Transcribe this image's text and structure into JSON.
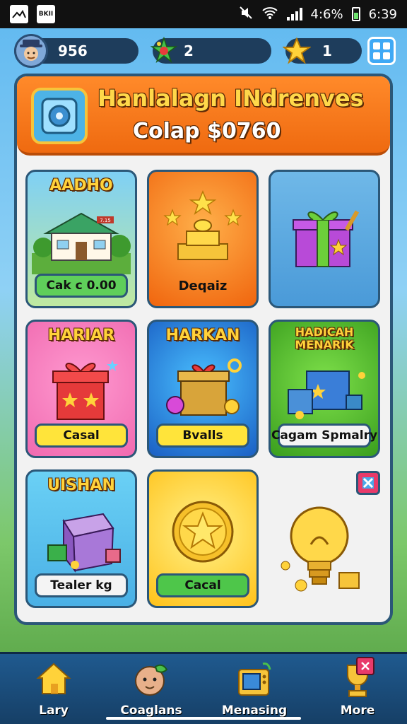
{
  "status_bar": {
    "battery": "4:6%",
    "time": "6:39",
    "app_badge": "BKII"
  },
  "resources": {
    "coins": "956",
    "gems": "2",
    "stars": "1"
  },
  "header": {
    "title": "Hanlalagn INdrenves",
    "subtitle": "Colap $0760"
  },
  "tiles": [
    {
      "title": "AADHO",
      "button": "Cak c 0.00",
      "sign": "7.15"
    },
    {
      "title": "",
      "button": "Deqaiz"
    },
    {
      "title": "",
      "button": ""
    },
    {
      "title": "HARIAR",
      "button": "Casal"
    },
    {
      "title": "HARKAN",
      "button": "Bvalls"
    },
    {
      "title": "HADICAH MENARIK",
      "button": "Cagam Spmalry"
    },
    {
      "title": "UISHAN",
      "button": "Tealer kg"
    },
    {
      "title": "",
      "button": "Cacal"
    }
  ],
  "nav": [
    {
      "label": "Lary",
      "icon": "house-icon"
    },
    {
      "label": "Coaglans",
      "icon": "character-icon"
    },
    {
      "label": "Menasing",
      "icon": "console-icon"
    },
    {
      "label": "More",
      "icon": "trophy-icon"
    }
  ],
  "colors": {
    "accent_orange": "#f07414",
    "panel_border": "#2b5778",
    "gold": "#ffd23a"
  }
}
